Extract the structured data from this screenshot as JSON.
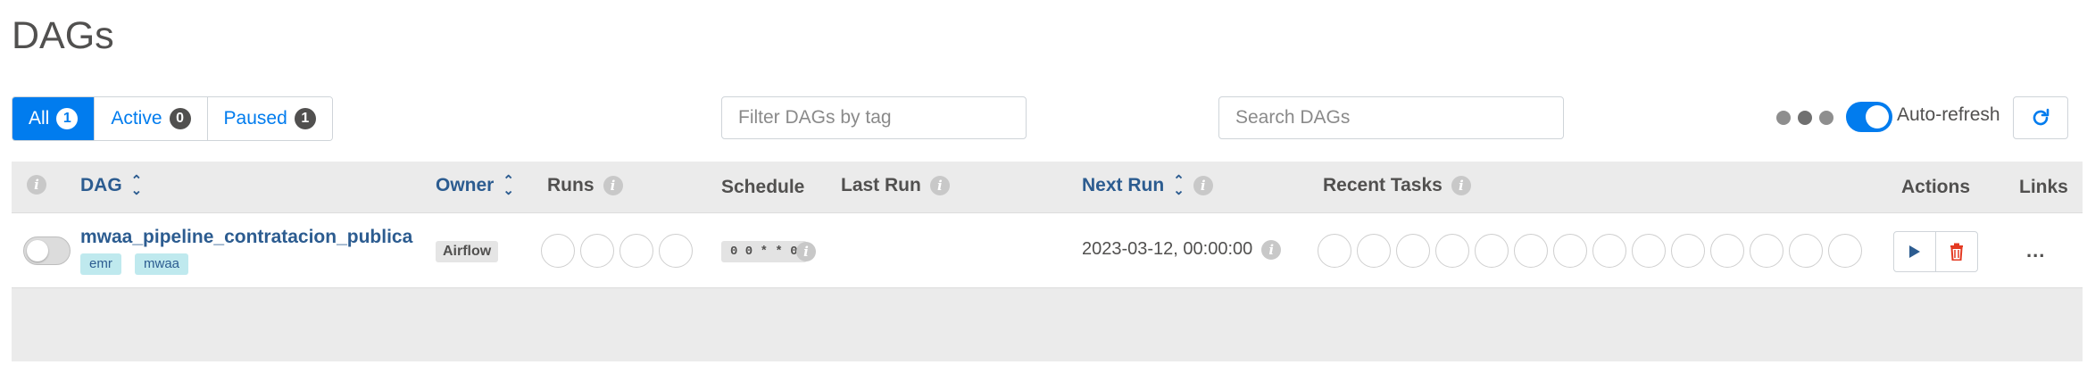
{
  "page": {
    "title": "DAGs"
  },
  "filters": [
    {
      "label": "All",
      "count": "1",
      "active": true
    },
    {
      "label": "Active",
      "count": "0",
      "active": false
    },
    {
      "label": "Paused",
      "count": "1",
      "active": false
    }
  ],
  "tag_filter": {
    "placeholder": "Filter DAGs by tag",
    "value": ""
  },
  "search": {
    "placeholder": "Search DAGs",
    "value": ""
  },
  "auto_refresh": {
    "label": "Auto-refresh",
    "enabled": true
  },
  "icons": {
    "refresh": "refresh-icon",
    "info": "info-icon",
    "sort": "sort-icon",
    "trigger": "play-icon",
    "delete": "trash-icon",
    "more": "more-icon"
  },
  "columns": {
    "dag": "DAG",
    "owner": "Owner",
    "runs": "Runs",
    "schedule": "Schedule",
    "last_run": "Last Run",
    "next_run": "Next Run",
    "recent_tasks": "Recent Tasks",
    "actions": "Actions",
    "links": "Links"
  },
  "rows": [
    {
      "dag_id": "mwaa_pipeline_contratacion_publica",
      "paused": true,
      "tags": [
        "emr",
        "mwaa"
      ],
      "owner": "Airflow",
      "schedule": "0 0 * * 0",
      "last_run": "",
      "next_run": "2023-03-12, 00:00:00",
      "runs_circles": 4,
      "recent_task_circles": 14,
      "links_more": "..."
    }
  ],
  "colors": {
    "accent": "#017cee",
    "link": "#2c5c90",
    "delete": "#e43921",
    "tag_bg": "#bfe9ee",
    "header_bg": "#ebebeb"
  }
}
